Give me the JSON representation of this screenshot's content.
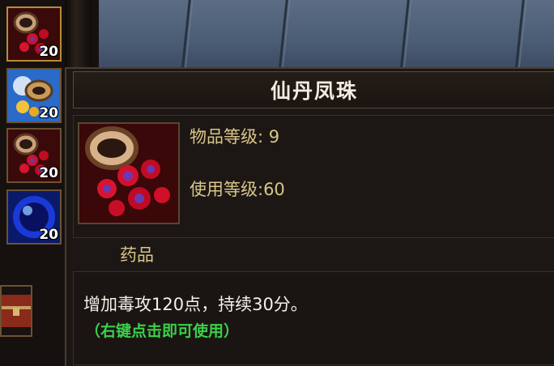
{
  "inventory": {
    "slots": [
      {
        "icon": "potion-jar-icon",
        "count": "20"
      },
      {
        "icon": "horn-scroll-icon",
        "count": "20"
      },
      {
        "icon": "potion-jar-icon",
        "count": "20"
      },
      {
        "icon": "blue-orb-icon",
        "count": "20"
      }
    ],
    "chest_icon": "chest-icon"
  },
  "tooltip": {
    "title": "仙丹凤珠",
    "item_icon": "potion-jar-icon",
    "item_level": "物品等级: 9",
    "use_level": "使用等级:60",
    "category": "药品",
    "description": "增加毒攻120点，持续30分。",
    "hint": "（右键点击即可使用）"
  },
  "colors": {
    "panel": "#1c1714",
    "border": "#4a3c2e",
    "stat_text": "#d8c58a",
    "hint_text": "#3bd04a",
    "title_text": "#f2ece2"
  }
}
